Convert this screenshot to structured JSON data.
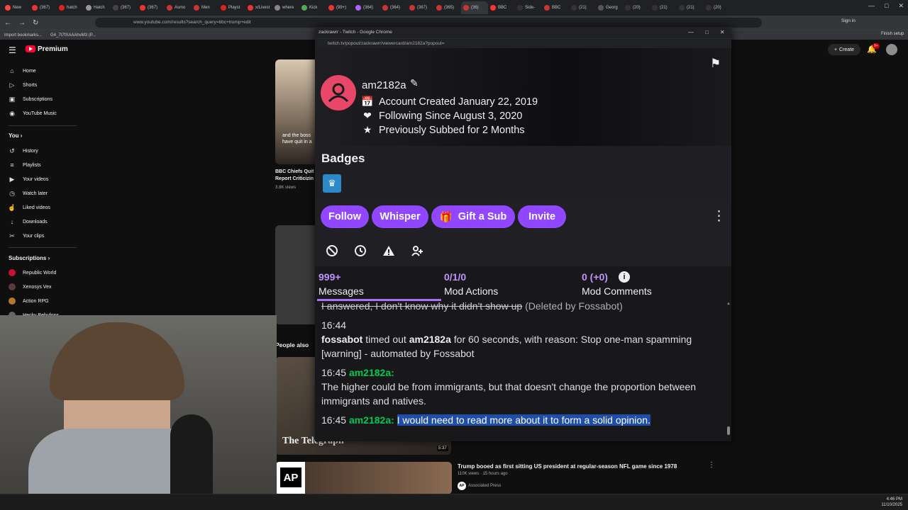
{
  "browser": {
    "tabs": [
      "New",
      "(367)",
      "hatch",
      "Hatch",
      "(367)",
      "(367)",
      "Asmo",
      "Men",
      "Playst",
      "x/Livest",
      "where",
      "Kick",
      "(99+)",
      "(364)",
      "(364)",
      "(367)",
      "(365)",
      "(36)",
      "BBC",
      "Side-",
      "BBC",
      "(21)",
      "Georg",
      "(20)",
      "(21)",
      "(21)",
      "(20)"
    ],
    "url": "www.youtube.com/results?search_query=bbc+trump+edit",
    "bookmarks": [
      "Import bookmarks...",
      "G4_7t7fXAAAhvM3 (P..."
    ],
    "finish_setup": "Finish setup",
    "sign_in": "Sign in"
  },
  "youtube": {
    "brand": "Premium",
    "create_label": "Create",
    "notif_count": "9+",
    "nav": [
      "Home",
      "Shorts",
      "Subscriptions",
      "YouTube Music"
    ],
    "you_header": "You",
    "you_items": [
      "History",
      "Playlists",
      "Your videos",
      "Watch later",
      "Liked videos",
      "Downloads",
      "Your clips"
    ],
    "subs_header": "Subscriptions",
    "subs": [
      "Republic World",
      "Xenosys Vex",
      "Action RPG",
      "Hecky Bebufons"
    ],
    "video1": {
      "title": "BBC Chiefs Quit Report Criticizin",
      "views": "3.8K views",
      "caption": "and the boss have quit in a"
    },
    "people_also": "People also",
    "telegraph": "The Telegraph",
    "duration": "5:37",
    "video2": {
      "title": "Trump booed as first sitting US president at regular-season NFL game since 1978",
      "meta": "110K views · 15 hours ago",
      "channel": "Associated Press",
      "logo": "AP"
    }
  },
  "twitch": {
    "window_title": "zackrawrr - Twitch - Google Chrome",
    "url": "twitch.tv/popout/zackrawrr/viewercard/am2182a?popout=",
    "username": "am2182a",
    "account_created": "Account Created January 22, 2019",
    "following_since": "Following Since August 3, 2020",
    "subbed": "Previously Subbed for 2 Months",
    "badges_title": "Badges",
    "buttons": {
      "follow": "Follow",
      "whisper": "Whisper",
      "gift": "Gift a Sub",
      "invite": "Invite"
    },
    "stats": [
      {
        "num": "999+",
        "label": "Messages"
      },
      {
        "num": "0/1/0",
        "label": "Mod Actions"
      },
      {
        "num": "0 (+0)",
        "label": "Mod Comments"
      }
    ],
    "messages": {
      "deleted_text": "I answered, I don't know why it didn't show up",
      "deleted_note": "(Deleted by Fossabot)",
      "t1": "16:44",
      "mod_name": "fossabot",
      "mod_action": "timed out",
      "mod_target": "am2182a",
      "mod_reason_a": "for 60 seconds, with reason: Stop one-man spamming",
      "mod_reason_b": "[warning] - automated by Fossabot",
      "t2": "16:45",
      "user_a": "am2182a:",
      "msg2": "The higher could be from immigrants, but that doesn't change the proportion between immigrants and natives.",
      "t3": "16:45",
      "user_b": "am2182a:",
      "msg3": "I would need to read more about it to form a solid opinion."
    }
  },
  "taskbar": {
    "time": "4:46 PM",
    "date": "11/10/2025"
  },
  "colors": {
    "twitch_purple": "#9147ff",
    "stat_purple": "#bf94ff",
    "chat_green": "#00c853",
    "yt_red": "#ff0033"
  }
}
